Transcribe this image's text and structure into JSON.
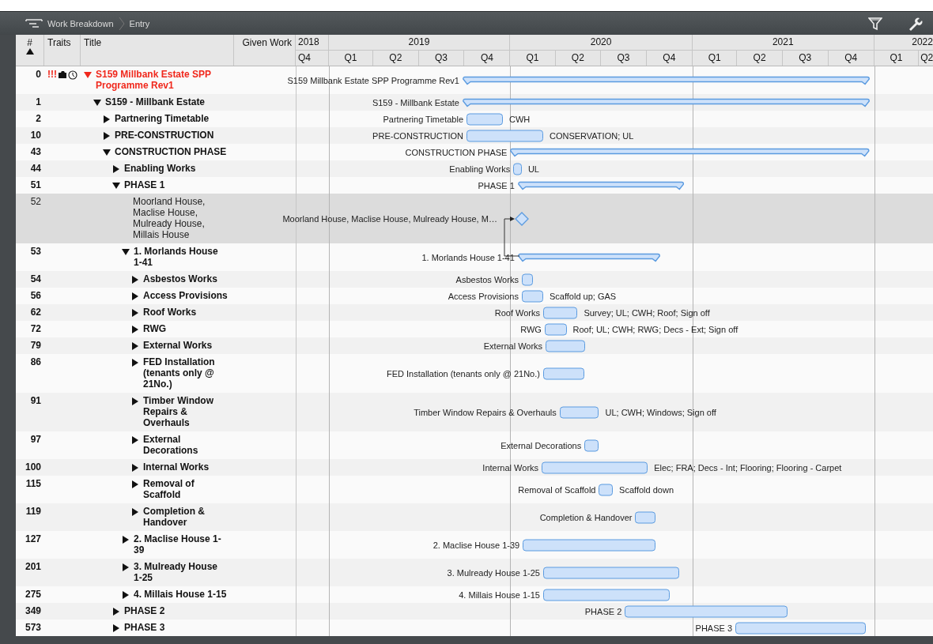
{
  "toolbar": {
    "breadcrumb": [
      "Work Breakdown",
      "Entry"
    ]
  },
  "columns": [
    {
      "label": "#",
      "sort_ascending": true
    },
    {
      "label": "Traits"
    },
    {
      "label": "Title"
    },
    {
      "label": "Given Work"
    }
  ],
  "timeline": {
    "years": [
      {
        "label": "2018",
        "quarters": [
          "Q4"
        ]
      },
      {
        "label": "2019",
        "quarters": [
          "Q1",
          "Q2",
          "Q3",
          "Q4"
        ]
      },
      {
        "label": "2020",
        "quarters": [
          "Q1",
          "Q2",
          "Q3",
          "Q4"
        ]
      },
      {
        "label": "2021",
        "quarters": [
          "Q1",
          "Q2",
          "Q3",
          "Q4"
        ]
      },
      {
        "label": "2022",
        "quarters": [
          "Q1",
          "Q2"
        ]
      }
    ]
  },
  "rows": [
    {
      "number": "0",
      "priority": "!!!",
      "has_attachment": true,
      "has_timer": true,
      "color": "#f0281c",
      "title": "S159 Millbank Estate SPP Programme Rev1",
      "selected": false,
      "expanded": true,
      "bar": {
        "kind": "summary",
        "label": "S159 Millbank Estate SPP Programme Rev1"
      },
      "children": [
        {
          "number": "1",
          "title": "S159 - Millbank Estate",
          "selected": false,
          "expanded": true,
          "bar": {
            "kind": "summary",
            "label": "S159 - Millbank Estate"
          },
          "children": [
            {
              "number": "2",
              "title": "Partnering Timetable",
              "selected": false,
              "expanded": false,
              "bar": {
                "kind": "task",
                "label": "Partnering Timetable",
                "note": "CWH"
              }
            },
            {
              "number": "10",
              "title": "PRE-CONSTRUCTION",
              "selected": false,
              "expanded": false,
              "bar": {
                "kind": "task",
                "label": "PRE-CONSTRUCTION",
                "note": "CONSERVATION; UL"
              }
            },
            {
              "number": "43",
              "title": "CONSTRUCTION PHASE",
              "selected": false,
              "expanded": true,
              "bar": {
                "kind": "summary",
                "label": "CONSTRUCTION PHASE"
              },
              "children": [
                {
                  "number": "44",
                  "title": "Enabling Works",
                  "selected": false,
                  "expanded": false,
                  "bar": {
                    "kind": "task",
                    "label": "Enabling Works",
                    "note": "UL"
                  }
                },
                {
                  "number": "51",
                  "title": "PHASE 1",
                  "selected": false,
                  "expanded": true,
                  "bar": {
                    "kind": "summary",
                    "label": "PHASE 1"
                  },
                  "children": [
                    {
                      "number": "52",
                      "title": "Moorland House, Maclise House, Mulready House, Millais House",
                      "selected": true,
                      "bar": {
                        "kind": "milestone",
                        "label": "Moorland House, Maclise House, Mulready House, M…"
                      }
                    },
                    {
                      "number": "53",
                      "title": "1. Morlands House 1-41",
                      "selected": false,
                      "expanded": true,
                      "link_to_previous": true,
                      "bar": {
                        "kind": "summary",
                        "label": "1. Morlands House 1-41"
                      },
                      "children": [
                        {
                          "number": "54",
                          "title": "Asbestos Works",
                          "selected": false,
                          "expanded": false,
                          "bar": {
                            "kind": "task",
                            "label": "Asbestos Works"
                          }
                        },
                        {
                          "number": "56",
                          "title": "Access Provisions",
                          "selected": false,
                          "expanded": false,
                          "bar": {
                            "kind": "task",
                            "label": "Access Provisions",
                            "note": "Scaffold up; GAS"
                          }
                        },
                        {
                          "number": "62",
                          "title": "Roof Works",
                          "selected": false,
                          "expanded": false,
                          "bar": {
                            "kind": "task",
                            "label": "Roof Works",
                            "note": "Survey; UL; CWH; Roof; Sign off"
                          }
                        },
                        {
                          "number": "72",
                          "title": "RWG",
                          "selected": false,
                          "expanded": false,
                          "bar": {
                            "kind": "task",
                            "label": "RWG",
                            "note": "Roof; UL; CWH; RWG; Decs - Ext; Sign off"
                          }
                        },
                        {
                          "number": "79",
                          "title": "External Works",
                          "selected": false,
                          "expanded": false,
                          "bar": {
                            "kind": "task",
                            "label": "External Works"
                          }
                        },
                        {
                          "number": "86",
                          "title": "FED Installation (tenants only @ 21No.)",
                          "selected": false,
                          "expanded": false,
                          "bar": {
                            "kind": "task",
                            "label": "FED Installation (tenants only @ 21No.)"
                          }
                        },
                        {
                          "number": "91",
                          "title": "Timber Window Repairs & Overhauls",
                          "selected": false,
                          "expanded": false,
                          "bar": {
                            "kind": "task",
                            "label": "Timber Window Repairs & Overhauls",
                            "note": "UL; CWH; Windows; Sign off"
                          }
                        },
                        {
                          "number": "97",
                          "title": "External Decorations",
                          "selected": false,
                          "expanded": false,
                          "bar": {
                            "kind": "task",
                            "label": "External Decorations"
                          }
                        },
                        {
                          "number": "100",
                          "title": "Internal Works",
                          "selected": false,
                          "expanded": false,
                          "bar": {
                            "kind": "task",
                            "label": "Internal Works",
                            "note": "Elec; FRA; Decs - Int; Flooring; Flooring - Carpet"
                          }
                        },
                        {
                          "number": "115",
                          "title": "Removal of Scaffold",
                          "selected": false,
                          "expanded": false,
                          "bar": {
                            "kind": "task",
                            "label": "Removal of Scaffold",
                            "note": "Scaffold down"
                          }
                        },
                        {
                          "number": "119",
                          "title": "Completion & Handover",
                          "selected": false,
                          "expanded": false,
                          "bar": {
                            "kind": "task",
                            "label": "Completion & Handover"
                          }
                        }
                      ]
                    },
                    {
                      "number": "127",
                      "title": "2. Maclise House 1-39",
                      "selected": false,
                      "expanded": false,
                      "bar": {
                        "kind": "task",
                        "label": "2. Maclise House 1-39"
                      }
                    },
                    {
                      "number": "201",
                      "title": "3. Mulready House 1-25",
                      "selected": false,
                      "expanded": false,
                      "bar": {
                        "kind": "task",
                        "label": "3. Mulready House 1-25"
                      }
                    },
                    {
                      "number": "275",
                      "title": "4. Millais House 1-15",
                      "selected": false,
                      "expanded": false,
                      "bar": {
                        "kind": "task",
                        "label": "4. Millais House 1-15"
                      }
                    }
                  ]
                },
                {
                  "number": "349",
                  "title": "PHASE 2",
                  "selected": false,
                  "expanded": false,
                  "bar": {
                    "kind": "task",
                    "label": "PHASE 2"
                  }
                },
                {
                  "number": "573",
                  "title": "PHASE 3",
                  "selected": false,
                  "expanded": false,
                  "bar": {
                    "kind": "task",
                    "label": "PHASE 3"
                  }
                }
              ]
            }
          ]
        }
      ]
    }
  ]
}
